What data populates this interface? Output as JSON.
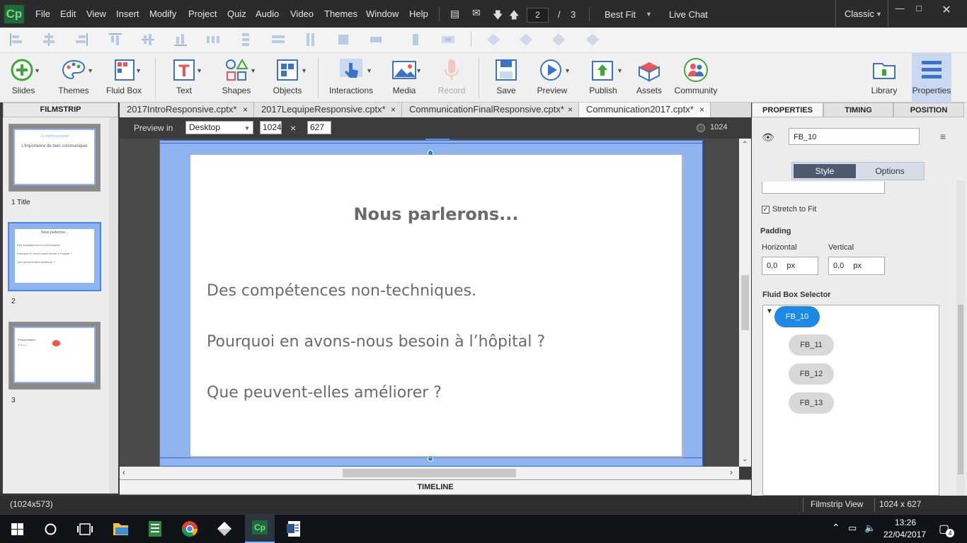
{
  "menubar": {
    "logo": "Cp",
    "items": [
      "File",
      "Edit",
      "View",
      "Insert",
      "Modify",
      "Project",
      "Quiz",
      "Audio",
      "Video",
      "Themes",
      "Window",
      "Help"
    ],
    "page_current": "2",
    "page_sep": "/",
    "page_total": "3",
    "zoom": "Best Fit",
    "live_chat": "Live Chat",
    "workspace": "Classic"
  },
  "toolbar": {
    "slides": "Slides",
    "themes": "Themes",
    "fluid_box": "Fluid Box",
    "text": "Text",
    "shapes": "Shapes",
    "objects": "Objects",
    "interactions": "Interactions",
    "media": "Media",
    "record": "Record",
    "save": "Save",
    "preview": "Preview",
    "publish": "Publish",
    "assets": "Assets",
    "community": "Community",
    "library": "Library",
    "properties": "Properties"
  },
  "filmstrip": {
    "header": "FILMSTRIP",
    "slides": [
      {
        "label": "1 Title",
        "title": "La communication",
        "subtitle": "L'importance de bien communiquer"
      },
      {
        "label": "2",
        "title": "Nous parlerons...",
        "lines": [
          "Des compétences non-techniques.",
          "Pourquoi en avons-nous besoin à l'hôpital ?",
          "Que peuvent-elles améliorer ?"
        ]
      },
      {
        "label": "3",
        "title": "Présidentation",
        "subtitle": "AT  Eva Le"
      }
    ]
  },
  "tabs": [
    {
      "label": "2017IntroResponsive.cptx*",
      "close": "×"
    },
    {
      "label": "2017LequipeResponsive.cptx*",
      "close": "×"
    },
    {
      "label": "CommunicationFinalResponsive.cptx*",
      "close": "×"
    },
    {
      "label": "Communication2017.cptx*",
      "close": "×"
    }
  ],
  "preview": {
    "label": "Preview in",
    "device": "Desktop",
    "width": "1024",
    "times": "×",
    "height": "627",
    "ruler_value": "1024"
  },
  "slide": {
    "title": "Nous parlerons...",
    "bullets": [
      "Des compétences non-techniques.",
      "Pourquoi en avons-nous besoin à l’hôpital ?",
      "Que peuvent-elles améliorer ?"
    ]
  },
  "timeline": "TIMELINE",
  "properties": {
    "tabs": [
      "PROPERTIES",
      "TIMING",
      "POSITION"
    ],
    "object_name": "FB_10",
    "style_tab": "Style",
    "options_tab": "Options",
    "stretch_label": "Stretch to Fit",
    "stretch_checked": true,
    "padding_label": "Padding",
    "horizontal_label": "Horizontal",
    "horizontal_value": "0,0",
    "horizontal_unit": "px",
    "vertical_label": "Vertical",
    "vertical_value": "0,0",
    "vertical_unit": "px",
    "selector_label": "Fluid Box Selector",
    "fluid_boxes": [
      "FB_10",
      "FB_11",
      "FB_12",
      "FB_13"
    ]
  },
  "status": {
    "left": "(1024x573)",
    "view": "Filmstrip View",
    "size": "1024 x 627"
  },
  "taskbar": {
    "time": "13:26",
    "date": "22/04/2017",
    "notifications": "4"
  },
  "colors": {
    "accent": "#4a86e8",
    "selected_pill": "#1e88e5",
    "slide_bg": "#8fb3ef"
  }
}
